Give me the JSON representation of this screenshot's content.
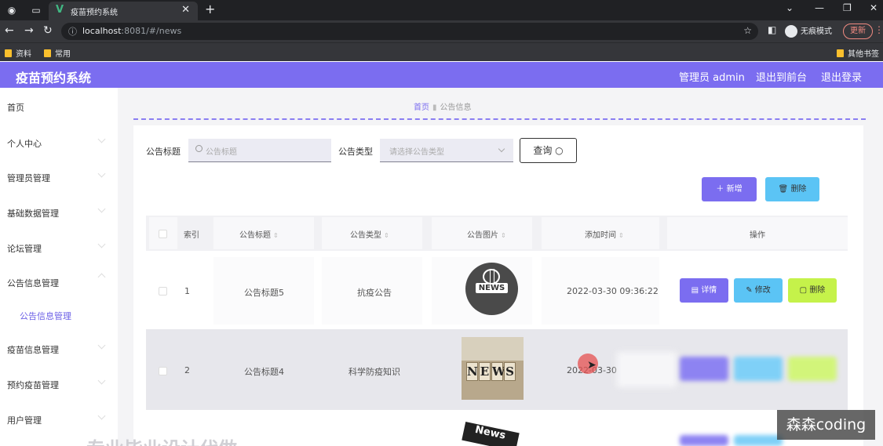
{
  "browser": {
    "tab_title": "疫苗预约系统",
    "url_host": "localhost",
    "url_rest": ":8081/#/news",
    "incognito_label": "无痕模式",
    "update_label": "更新",
    "bookmarks": [
      "资料",
      "常用"
    ],
    "other_bookmarks": "其他书签"
  },
  "header": {
    "title": "疫苗预约系统",
    "user_label": "管理员 admin",
    "to_front_label": "退出到前台",
    "logout_label": "退出登录"
  },
  "sidebar": {
    "items": [
      {
        "label": "首页"
      },
      {
        "label": "个人中心"
      },
      {
        "label": "管理员管理"
      },
      {
        "label": "基础数据管理"
      },
      {
        "label": "论坛管理"
      },
      {
        "label": "公告信息管理"
      },
      {
        "label": "公告信息管理"
      },
      {
        "label": "疫苗信息管理"
      },
      {
        "label": "预约疫苗管理"
      },
      {
        "label": "用户管理"
      }
    ]
  },
  "breadcrumb": {
    "home": "首页",
    "current": "公告信息"
  },
  "filters": {
    "title_label": "公告标题",
    "title_placeholder": "公告标题",
    "type_label": "公告类型",
    "type_placeholder": "请选择公告类型",
    "query_label": "查询"
  },
  "toolbar": {
    "add_label": "新增",
    "delete_label": "删除"
  },
  "table": {
    "columns": [
      "索引",
      "公告标题",
      "公告类型",
      "公告图片",
      "添加时间",
      "操作"
    ],
    "rows": [
      {
        "index": "1",
        "title": "公告标题5",
        "type": "抗疫公告",
        "image_label": "NEWS",
        "time": "2022-03-30 09:36:22"
      },
      {
        "index": "2",
        "title": "公告标题4",
        "type": "科学防疫知识",
        "image_label": "NEWS",
        "time": "2022-03-30"
      }
    ],
    "row_actions": {
      "detail": "详情",
      "edit": "修改",
      "delete": "删除"
    },
    "partial_image_label": "News"
  },
  "overlay_text": "专业毕业设计代做",
  "watermark": "森森coding"
}
